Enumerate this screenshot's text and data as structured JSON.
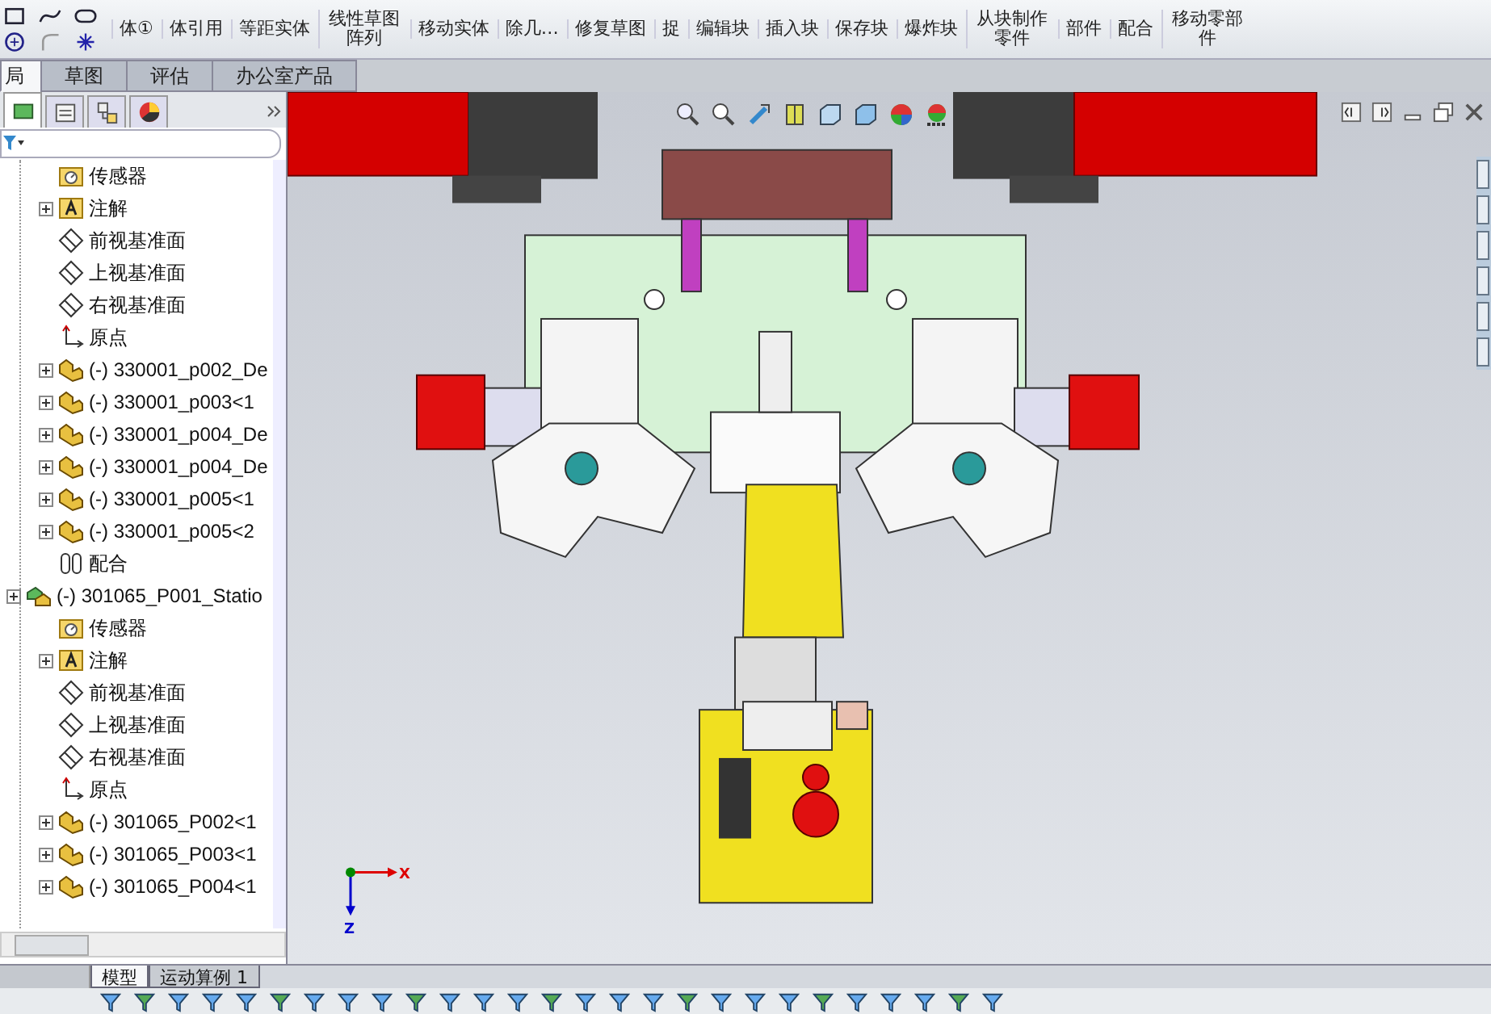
{
  "ribbon": {
    "items": [
      {
        "label": "体①"
      },
      {
        "label": "体引用"
      },
      {
        "label": "等距实体"
      },
      {
        "label": "线性草图阵列"
      },
      {
        "label": "移动实体"
      },
      {
        "label": "除几…"
      },
      {
        "label": "修复草图"
      },
      {
        "label": "捉"
      },
      {
        "label": "编辑块"
      },
      {
        "label": "插入块"
      },
      {
        "label": "保存块"
      },
      {
        "label": "爆炸块"
      },
      {
        "label": "从块制作零件"
      },
      {
        "label": "部件"
      },
      {
        "label": "配合"
      },
      {
        "label": "移动零部件"
      }
    ]
  },
  "tabs": [
    {
      "label": "局",
      "selected": true
    },
    {
      "label": "草图",
      "selected": false
    },
    {
      "label": "评估",
      "selected": false
    },
    {
      "label": "办公室产品",
      "selected": false
    }
  ],
  "panel_tabs": [
    {
      "kind": "feature",
      "selected": true
    },
    {
      "kind": "property",
      "selected": false
    },
    {
      "kind": "config",
      "selected": false
    },
    {
      "kind": "display",
      "selected": false
    }
  ],
  "tree": {
    "upper_group": [
      {
        "label": "传感器",
        "kind": "sensor",
        "expandable": false
      },
      {
        "label": "注解",
        "kind": "annotation",
        "expandable": true
      },
      {
        "label": "前视基准面",
        "kind": "plane",
        "expandable": false
      },
      {
        "label": "上视基准面",
        "kind": "plane",
        "expandable": false
      },
      {
        "label": "右视基准面",
        "kind": "plane",
        "expandable": false
      },
      {
        "label": "原点",
        "kind": "origin",
        "expandable": false
      },
      {
        "label": "(-) 330001_p002_De",
        "kind": "part",
        "expandable": true
      },
      {
        "label": "(-) 330001_p003<1",
        "kind": "part",
        "expandable": true
      },
      {
        "label": "(-) 330001_p004_De",
        "kind": "part",
        "expandable": true
      },
      {
        "label": "(-) 330001_p004_De",
        "kind": "part",
        "expandable": true
      },
      {
        "label": "(-) 330001_p005<1",
        "kind": "part",
        "expandable": true
      },
      {
        "label": "(-) 330001_p005<2",
        "kind": "part",
        "expandable": true
      },
      {
        "label": "配合",
        "kind": "mates",
        "expandable": false
      }
    ],
    "items": [
      {
        "label": "(-) 301065_P001_Statio",
        "kind": "assembly",
        "expandable": true,
        "children": [
          {
            "label": "传感器",
            "kind": "sensor",
            "expandable": false
          },
          {
            "label": "注解",
            "kind": "annotation",
            "expandable": true
          },
          {
            "label": "前视基准面",
            "kind": "plane",
            "expandable": false
          },
          {
            "label": "上视基准面",
            "kind": "plane",
            "expandable": false
          },
          {
            "label": "右视基准面",
            "kind": "plane",
            "expandable": false
          },
          {
            "label": "原点",
            "kind": "origin",
            "expandable": false
          },
          {
            "label": "(-) 301065_P002<1",
            "kind": "part",
            "expandable": true
          },
          {
            "label": "(-) 301065_P003<1",
            "kind": "part",
            "expandable": true
          },
          {
            "label": "(-) 301065_P004<1",
            "kind": "part",
            "expandable": true
          }
        ]
      }
    ]
  },
  "triad": {
    "x_label": "X",
    "z_label": "Z"
  },
  "bottom_tabs": [
    {
      "label": "模型",
      "selected": true
    },
    {
      "label": "运动算例 1",
      "selected": false
    }
  ]
}
